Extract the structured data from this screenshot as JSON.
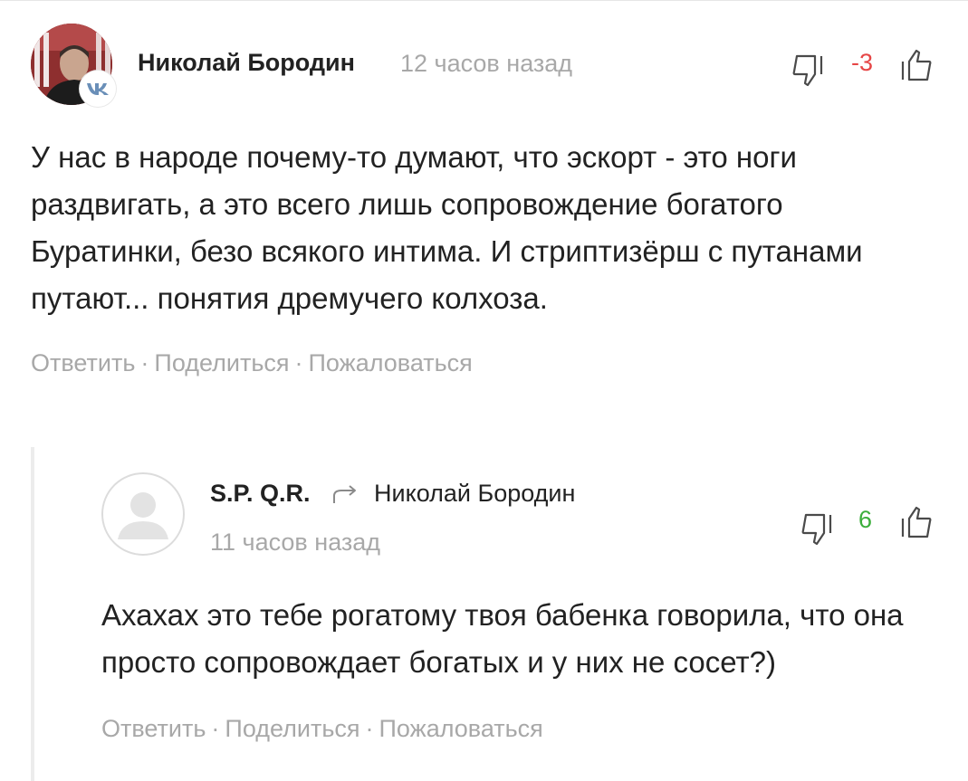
{
  "comments": [
    {
      "author": "Николай Бородин",
      "time": "12 часов назад",
      "avatar": "user-photo",
      "badge": "vk-icon",
      "score": "-3",
      "text": "У нас в народе почему-то думают, что эскорт - это ноги раздвигать, а это всего лишь сопровождение богатого Буратинки, безо всякого интима. И стриптизёрш с путанами путают... понятия дремучего колхоза.",
      "actions": {
        "reply": "Ответить",
        "share": "Поделиться",
        "report": "Пожаловаться",
        "separator": "·"
      }
    },
    {
      "author": "S.P. Q.R.",
      "reply_to": "Николай Бородин",
      "time": "11 часов назад",
      "avatar": "default-avatar-icon",
      "score": "6",
      "text": "Ахахах это тебе рогатому твоя бабенка говорила, что она просто сопровождает богатых и у них не сосет?)",
      "actions": {
        "reply": "Ответить",
        "share": "Поделиться",
        "report": "Пожаловаться",
        "separator": "·"
      }
    }
  ],
  "colors": {
    "text": "#222222",
    "muted": "#a8a8a8",
    "negative": "#e64646",
    "positive": "#3cae3c",
    "icon": "#4a4a4a"
  },
  "icons": [
    "thumb-down-icon",
    "thumb-up-icon",
    "reply-arrow-icon",
    "vk-icon"
  ]
}
